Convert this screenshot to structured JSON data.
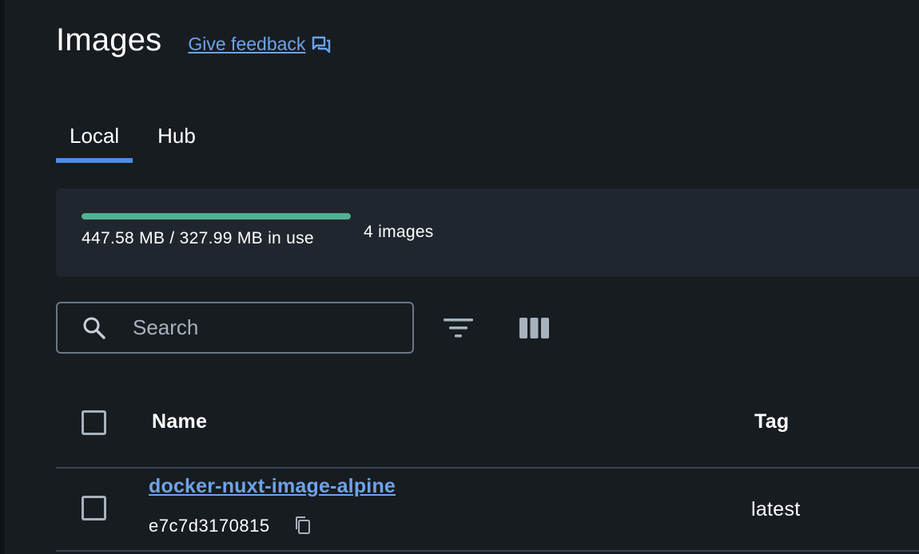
{
  "header": {
    "title": "Images",
    "feedback_label": "Give feedback",
    "feedback_icon": "feedback-chat-icon"
  },
  "tabs": [
    {
      "label": "Local",
      "active": true
    },
    {
      "label": "Hub",
      "active": false
    }
  ],
  "usage": {
    "text": "447.58 MB / 327.99 MB in use",
    "bar_fill_percent": 100,
    "image_count": "4 images",
    "bar_color": "#4fb393"
  },
  "toolbar": {
    "search_placeholder": "Search",
    "search_icon": "search-icon",
    "filter_icon": "filter-icon",
    "columns_icon": "columns-icon"
  },
  "table": {
    "columns": [
      "Name",
      "Tag"
    ],
    "rows": [
      {
        "name": "docker-nuxt-image-alpine",
        "id": "e7c7d3170815",
        "tag": "latest"
      }
    ]
  },
  "colors": {
    "background": "#171c21",
    "accent": "#4a8ee8",
    "link": "#6ea3e8"
  }
}
